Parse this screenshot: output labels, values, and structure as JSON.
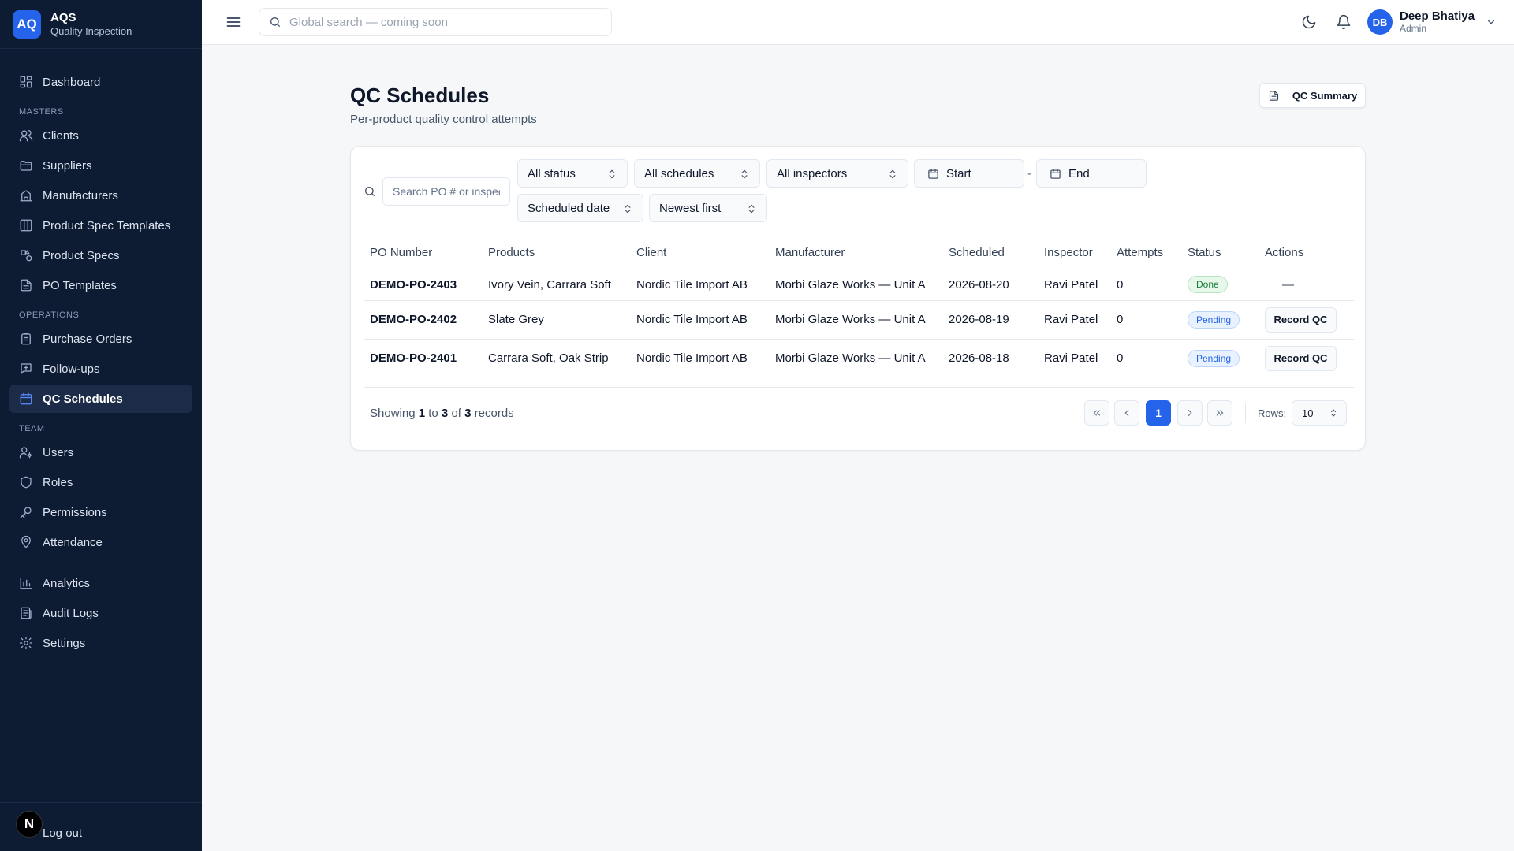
{
  "brand": {
    "logo": "AQ",
    "name": "AQS",
    "subtitle": "Quality Inspection"
  },
  "sidebar": {
    "items": [
      {
        "label": "Dashboard",
        "icon": "dashboard-icon"
      },
      {
        "section": "MASTERS"
      },
      {
        "label": "Clients",
        "icon": "users-icon"
      },
      {
        "label": "Suppliers",
        "icon": "folder-icon"
      },
      {
        "label": "Manufacturers",
        "icon": "building-icon"
      },
      {
        "label": "Product Spec Templates",
        "icon": "columns-icon"
      },
      {
        "label": "Product Specs",
        "icon": "shapes-icon"
      },
      {
        "label": "PO Templates",
        "icon": "file-icon"
      },
      {
        "section": "OPERATIONS"
      },
      {
        "label": "Purchase Orders",
        "icon": "clipboard-icon"
      },
      {
        "label": "Follow-ups",
        "icon": "message-icon"
      },
      {
        "label": "QC Schedules",
        "icon": "calendar-icon",
        "active": true
      },
      {
        "section": "TEAM"
      },
      {
        "label": "Users",
        "icon": "user-key-icon"
      },
      {
        "label": "Roles",
        "icon": "shield-icon"
      },
      {
        "label": "Permissions",
        "icon": "key-icon"
      },
      {
        "label": "Attendance",
        "icon": "map-pin-icon"
      },
      {
        "label": "Analytics",
        "icon": "bar-chart-icon"
      },
      {
        "label": "Audit Logs",
        "icon": "logs-icon"
      },
      {
        "label": "Settings",
        "icon": "gear-icon"
      }
    ],
    "footer": {
      "badge": "N",
      "logout": "Log out"
    }
  },
  "header": {
    "search_placeholder": "Global search — coming soon",
    "user": {
      "initials": "DB",
      "name": "Deep Bhatiya",
      "role": "Admin"
    }
  },
  "page": {
    "title": "QC Schedules",
    "subtitle": "Per-product quality control attempts",
    "summary_button": "QC Summary"
  },
  "filters": {
    "search_placeholder": "Search PO # or inspector",
    "status": "All status",
    "schedules": "All schedules",
    "inspectors": "All inspectors",
    "start": "Start",
    "separator": "-",
    "end": "End",
    "sort_field": "Scheduled date",
    "sort_order": "Newest first"
  },
  "table": {
    "columns": [
      "PO Number",
      "Products",
      "Client",
      "Manufacturer",
      "Scheduled",
      "Inspector",
      "Attempts",
      "Status",
      "Actions"
    ],
    "rows": [
      {
        "po": "DEMO-PO-2403",
        "products": "Ivory Vein, Carrara Soft",
        "client": "Nordic Tile Import AB",
        "manufacturer": "Morbi Glaze Works — Unit A",
        "scheduled": "2026-08-20",
        "inspector": "Ravi Patel",
        "attempts": "0",
        "status": "Done",
        "action": "—"
      },
      {
        "po": "DEMO-PO-2402",
        "products": "Slate Grey",
        "client": "Nordic Tile Import AB",
        "manufacturer": "Morbi Glaze Works — Unit A",
        "scheduled": "2026-08-19",
        "inspector": "Ravi Patel",
        "attempts": "0",
        "status": "Pending",
        "action": "Record QC"
      },
      {
        "po": "DEMO-PO-2401",
        "products": "Carrara Soft, Oak Strip",
        "client": "Nordic Tile Import AB",
        "manufacturer": "Morbi Glaze Works — Unit A",
        "scheduled": "2026-08-18",
        "inspector": "Ravi Patel",
        "attempts": "0",
        "status": "Pending",
        "action": "Record QC"
      }
    ]
  },
  "pagination": {
    "showing_prefix": "Showing",
    "from": "1",
    "to_word": "to",
    "to": "3",
    "of_word": "of",
    "total": "3",
    "suffix": "records",
    "current_page": "1",
    "rows_label": "Rows:",
    "rows_value": "10"
  },
  "colors": {
    "sidebar_bg": "#0d1b33",
    "accent": "#2563eb",
    "done": "#15803d",
    "pending": "#2563eb"
  }
}
